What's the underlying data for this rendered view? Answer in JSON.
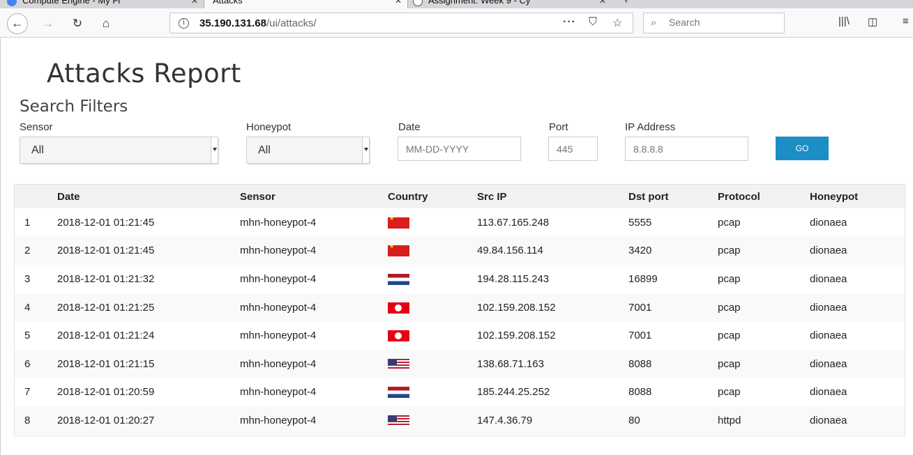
{
  "browser": {
    "tabs": [
      {
        "title": "Compute Engine - My Fi",
        "active": false
      },
      {
        "title": "Attacks",
        "active": true
      },
      {
        "title": "Assignment: Week 9 - Cy",
        "active": false
      }
    ],
    "url_host": "35.190.131.68",
    "url_path": "/ui/attacks/",
    "search_placeholder": "Search"
  },
  "page": {
    "title": "Attacks Report",
    "filters_title": "Search Filters"
  },
  "filters": {
    "sensor_label": "Sensor",
    "sensor_value": "All",
    "honeypot_label": "Honeypot",
    "honeypot_value": "All",
    "date_label": "Date",
    "date_placeholder": "MM-DD-YYYY",
    "port_label": "Port",
    "port_placeholder": "445",
    "ip_label": "IP Address",
    "ip_placeholder": "8.8.8.8",
    "go_label": "GO"
  },
  "table": {
    "headers": [
      "",
      "Date",
      "Sensor",
      "Country",
      "Src IP",
      "Dst port",
      "Protocol",
      "Honeypot"
    ],
    "rows": [
      {
        "num": "1",
        "date": "2018-12-01 01:21:45",
        "sensor": "mhn-honeypot-4",
        "flag": "cn",
        "src_ip": "113.67.165.248",
        "dst_port": "5555",
        "protocol": "pcap",
        "honeypot": "dionaea"
      },
      {
        "num": "2",
        "date": "2018-12-01 01:21:45",
        "sensor": "mhn-honeypot-4",
        "flag": "cn",
        "src_ip": "49.84.156.114",
        "dst_port": "3420",
        "protocol": "pcap",
        "honeypot": "dionaea"
      },
      {
        "num": "3",
        "date": "2018-12-01 01:21:32",
        "sensor": "mhn-honeypot-4",
        "flag": "nl",
        "src_ip": "194.28.115.243",
        "dst_port": "16899",
        "protocol": "pcap",
        "honeypot": "dionaea"
      },
      {
        "num": "4",
        "date": "2018-12-01 01:21:25",
        "sensor": "mhn-honeypot-4",
        "flag": "tn",
        "src_ip": "102.159.208.152",
        "dst_port": "7001",
        "protocol": "pcap",
        "honeypot": "dionaea"
      },
      {
        "num": "5",
        "date": "2018-12-01 01:21:24",
        "sensor": "mhn-honeypot-4",
        "flag": "tn",
        "src_ip": "102.159.208.152",
        "dst_port": "7001",
        "protocol": "pcap",
        "honeypot": "dionaea"
      },
      {
        "num": "6",
        "date": "2018-12-01 01:21:15",
        "sensor": "mhn-honeypot-4",
        "flag": "us",
        "src_ip": "138.68.71.163",
        "dst_port": "8088",
        "protocol": "pcap",
        "honeypot": "dionaea"
      },
      {
        "num": "7",
        "date": "2018-12-01 01:20:59",
        "sensor": "mhn-honeypot-4",
        "flag": "nl",
        "src_ip": "185.244.25.252",
        "dst_port": "8088",
        "protocol": "pcap",
        "honeypot": "dionaea"
      },
      {
        "num": "8",
        "date": "2018-12-01 01:20:27",
        "sensor": "mhn-honeypot-4",
        "flag": "us",
        "src_ip": "147.4.36.79",
        "dst_port": "80",
        "protocol": "httpd",
        "honeypot": "dionaea"
      }
    ]
  },
  "colors": {
    "go_button": "#1d8ec5",
    "table_header_bg": "#f2f2f2",
    "stripe_bg": "#f9f9f9"
  }
}
